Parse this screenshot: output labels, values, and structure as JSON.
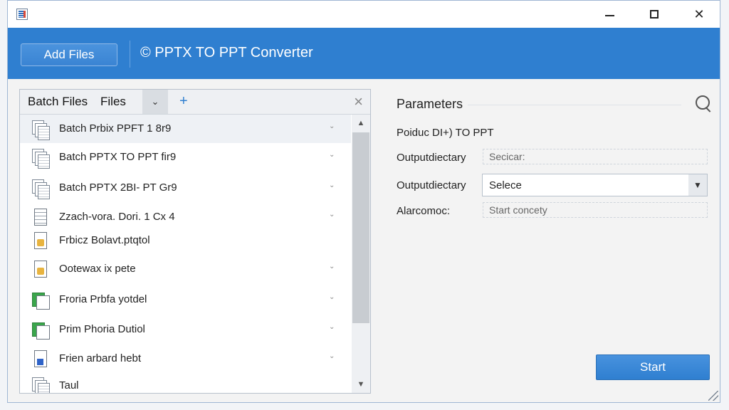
{
  "titlebar": {
    "minimize": "—",
    "maximize": "☐",
    "close": "✕"
  },
  "header": {
    "add_files": "Add Files",
    "title": "© PPTX TO PPT Converter"
  },
  "left_panel": {
    "tab_batch": "Batch Files",
    "tab_files": "Files",
    "tab_dropdown": "⌄",
    "tab_add": "+",
    "tab_close": "×",
    "rows": [
      {
        "label": "Batch Prbix PPFT 1 8r9",
        "icon": "stacked-pages-icon",
        "chevron": true
      },
      {
        "label": "Batch PPTX TO PPT fir9",
        "icon": "stacked-pages-icon",
        "chevron": true
      },
      {
        "label": "Batch PPTX 2BI- PT Gr9",
        "icon": "stacked-pages-icon",
        "chevron": true
      },
      {
        "label": "Zzach-vora. Dori. 1 Cx 4",
        "icon": "document-icon",
        "chevron": true
      },
      {
        "label": "Frbicz Bolavt.ptqtol",
        "icon": "yellow-doc-icon",
        "chevron": false
      },
      {
        "label": "Ootewax ix pete",
        "icon": "yellow-doc-icon",
        "chevron": true
      },
      {
        "label": "Froria Prbfa yotdel",
        "icon": "green-window-icon",
        "chevron": true
      },
      {
        "label": "Prim Phoria Dutiol",
        "icon": "green-window-icon",
        "chevron": true
      },
      {
        "label": "Frien arbard hebt",
        "icon": "blue-doc-icon",
        "chevron": true
      },
      {
        "label": "Taul",
        "icon": "stacked-pages-icon",
        "chevron": false
      }
    ],
    "scroll_up": "▲",
    "scroll_down": "▼"
  },
  "params": {
    "title": "Parameters",
    "mode_label": "Poiduc DI+) TO PPT",
    "output_label_1": "Outputdiectary",
    "output_value_1": "Secicar:",
    "output_label_2": "Outputdiectary",
    "select_value": "Selece",
    "alarm_label": "Alarcomoc:",
    "alarm_value": "Start concety"
  },
  "start_button": "Start"
}
